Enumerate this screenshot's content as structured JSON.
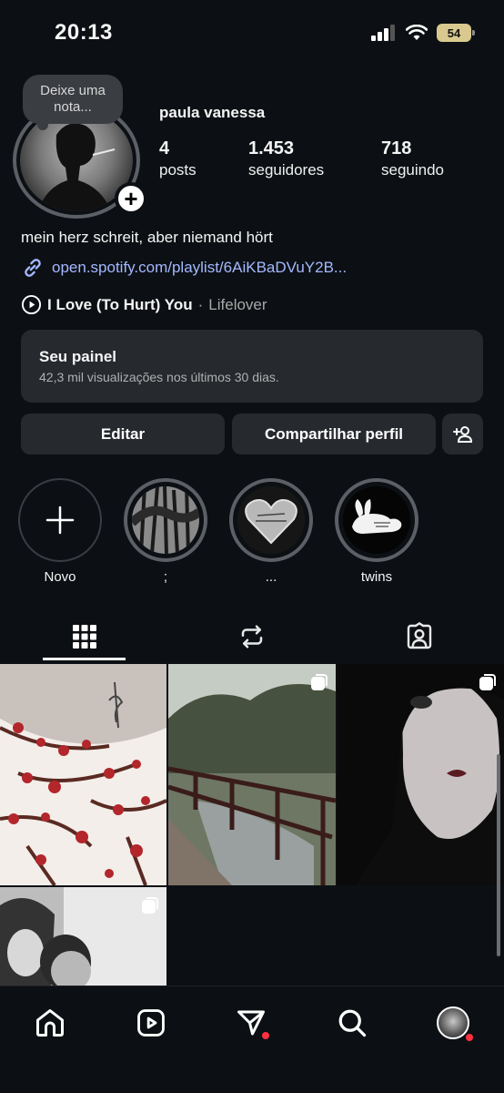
{
  "status_bar": {
    "time": "20:13",
    "battery": "54"
  },
  "profile": {
    "note_placeholder": "Deixe uma nota...",
    "username": "paula vanessa",
    "stats": [
      {
        "value": "4",
        "label": "posts"
      },
      {
        "value": "1.453",
        "label": "seguidores"
      },
      {
        "value": "718",
        "label": "seguindo"
      }
    ],
    "bio": "mein herz schreit, aber niemand hört",
    "link": "open.spotify.com/playlist/6AiKBaDVuY2B...",
    "music": {
      "title": "I Love (To Hurt) You",
      "separator": "·",
      "artist": "Lifelover"
    }
  },
  "panel": {
    "title": "Seu painel",
    "subtitle": "42,3 mil visualizações nos últimos 30 dias."
  },
  "buttons": {
    "edit": "Editar",
    "share": "Compartilhar perfil"
  },
  "highlights": [
    {
      "label": "Novo"
    },
    {
      "label": ";"
    },
    {
      "label": "..."
    },
    {
      "label": "twins"
    }
  ],
  "tabs": [
    {
      "icon": "grid-icon"
    },
    {
      "icon": "reposts-icon"
    },
    {
      "icon": "tagged-icon"
    }
  ],
  "nav": [
    {
      "icon": "home-icon"
    },
    {
      "icon": "reels-icon"
    },
    {
      "icon": "send-icon"
    },
    {
      "icon": "search-icon"
    },
    {
      "icon": "profile-avatar"
    }
  ],
  "colors": {
    "background": "#0c1014",
    "surface": "#26292e",
    "link": "#a4b8ff",
    "notification": "#ff3040"
  }
}
